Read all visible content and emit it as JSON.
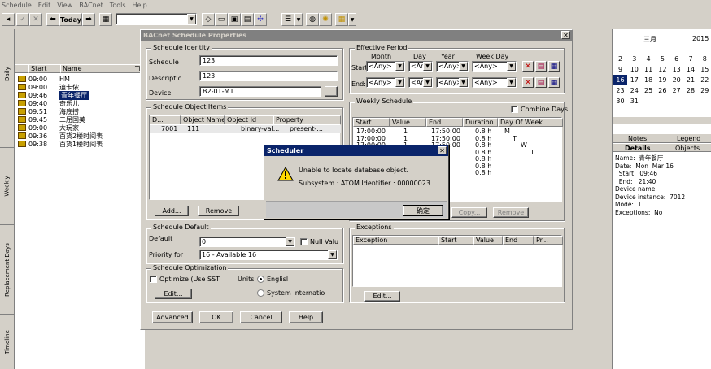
{
  "menu": [
    "Schedule",
    "Edit",
    "View",
    "BACnet",
    "Tools",
    "Help"
  ],
  "toolbar": {
    "today_label": "Today"
  },
  "side_tabs": [
    "Daily",
    "Weekly",
    "Replacement Days",
    "Timeline"
  ],
  "list": {
    "headers": [
      "Start",
      "Name",
      "Ti"
    ],
    "rows": [
      {
        "start": "09:00",
        "name": "HM"
      },
      {
        "start": "09:00",
        "name": "迪卡侬"
      },
      {
        "start": "09:46",
        "name": "青年餐厅"
      },
      {
        "start": "09:40",
        "name": "奇乐儿"
      },
      {
        "start": "09:51",
        "name": "海底捞"
      },
      {
        "start": "09:45",
        "name": "二屈国美"
      },
      {
        "start": "09:00",
        "name": "大玩家"
      },
      {
        "start": "09:36",
        "name": "百货2楼时间表"
      },
      {
        "start": "09:38",
        "name": "百货1楼时间表"
      }
    ]
  },
  "calendar": {
    "month": "三月",
    "year": "2015",
    "rows": [
      [
        "1",
        "2",
        "3",
        "4",
        "5",
        "6",
        "7"
      ],
      [
        "2",
        "3",
        "4",
        "5",
        "6",
        "7",
        "8"
      ],
      [
        "9",
        "10",
        "11",
        "12",
        "13",
        "14",
        "15"
      ],
      [
        "16",
        "17",
        "18",
        "19",
        "20",
        "21",
        "22"
      ],
      [
        "23",
        "24",
        "25",
        "26",
        "27",
        "28",
        "29"
      ],
      [
        "30",
        "31",
        "",
        "",
        "",
        "",
        ""
      ]
    ]
  },
  "right_tabs": {
    "notes": "Notes",
    "legend": "Legend",
    "details": "Details",
    "objects": "Objects"
  },
  "details_text": [
    "Name:  青年餐厅",
    "Date:  Mon  Mar 16",
    "  Start:  09:46",
    "  End:   21:40",
    "Device name:",
    "Device instance:  7012",
    "Mode:  1",
    "Exceptions:  No"
  ],
  "dialog": {
    "title": "BACnet Schedule Properties",
    "identity": {
      "title": "Schedule Identity",
      "schedule_label": "Schedule",
      "schedule_value": "123",
      "description_label": "Descriptic",
      "description_value": "123",
      "device_label": "Device",
      "device_value": "B2-01-M1",
      "browse_label": "..."
    },
    "period": {
      "title": "Effective Period",
      "col_month": "Month",
      "col_day": "Day",
      "col_year": "Year",
      "col_weekday": "Week Day",
      "start_label": "Start",
      "end_label": "End:",
      "any": "<Any>"
    },
    "object_items": {
      "title": "Schedule Object Items",
      "headers": [
        "D...",
        "Object Name",
        "Object Id",
        "Property"
      ],
      "row": [
        "7001",
        "111",
        "binary-val...",
        "present-..."
      ],
      "add_label": "Add...",
      "remove_label": "Remove"
    },
    "weekly": {
      "title": "Weekly Schedule",
      "combine_label": "Combine Days",
      "headers": [
        "Start",
        "Value",
        "End",
        "Duration",
        "Day Of Week"
      ],
      "rows": [
        [
          "17:00:00",
          "1",
          "17:50:00",
          "0.8 h",
          "M"
        ],
        [
          "17:00:00",
          "1",
          "17:50:00",
          "0.8 h",
          "T"
        ],
        [
          "17:00:00",
          "1",
          "17:50:00",
          "0.8 h",
          "W"
        ],
        [
          "",
          "",
          "",
          "0.8 h",
          "T"
        ],
        [
          "",
          "",
          "",
          "0.8 h",
          ""
        ],
        [
          "",
          "",
          "",
          "0.8 h",
          ""
        ],
        [
          "",
          "",
          "",
          "0.8 h",
          ""
        ]
      ],
      "copy_label": "Copy...",
      "remove_label": "Remove"
    },
    "default": {
      "title": "Schedule Default",
      "default_label": "Default",
      "default_value": "0",
      "null_label": "Null Valu",
      "priority_label": "Priority for",
      "priority_value": "16 - Available 16"
    },
    "optimization": {
      "title": "Schedule Optimization",
      "optimize_label": "Optimize (Use SST",
      "units_label": "Units",
      "english_label": "Englisl",
      "si_label": "System Internatio",
      "edit_label": "Edit..."
    },
    "exceptions": {
      "title": "Exceptions",
      "headers": [
        "Exception",
        "Start",
        "Value",
        "End",
        "Pr..."
      ],
      "edit_label": "Edit..."
    },
    "buttons": {
      "advanced": "Advanced",
      "ok": "OK",
      "cancel": "Cancel",
      "help": "Help"
    }
  },
  "alert": {
    "title": "Scheduler",
    "message": "Unable to locate database object.",
    "detail": "Subsystem : ATOM  Identifier   :   00000023",
    "ok_label": "确定"
  },
  "colors": {
    "title_active": "#0a246a",
    "title_inactive": "#808080",
    "selection": "#0a246a"
  }
}
